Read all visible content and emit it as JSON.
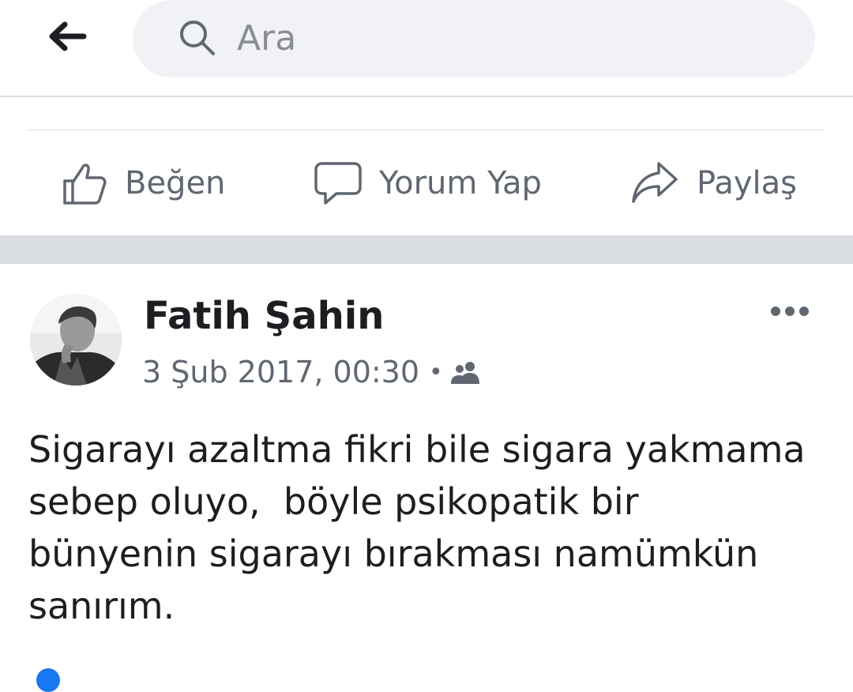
{
  "search": {
    "placeholder": "Ara",
    "icon": "search-icon"
  },
  "header": {
    "back_icon": "back-arrow-icon"
  },
  "previous_post": {
    "actions": [
      {
        "label": "Beğen",
        "icon": "thumbs-up-icon"
      },
      {
        "label": "Yorum Yap",
        "icon": "comment-icon"
      },
      {
        "label": "Paylaş",
        "icon": "share-icon"
      }
    ]
  },
  "post": {
    "author": "Fatih Şahin",
    "timestamp": "3 Şub 2017, 00:30",
    "separator": "•",
    "audience_icon": "friends-icon",
    "more_icon": "more-options-icon",
    "text": "Sigarayı azaltma fikri bile sigara yakmama\nsebep oluyo,  böyle psikopatik bir\nbünyenin sigarayı bırakması namümkün\nsanırım."
  },
  "colors": {
    "background": "#ffffff",
    "search_bg": "#f0f2f5",
    "separator": "#dadde1",
    "secondary_text": "#606770",
    "primary_text": "#1c1e21"
  }
}
